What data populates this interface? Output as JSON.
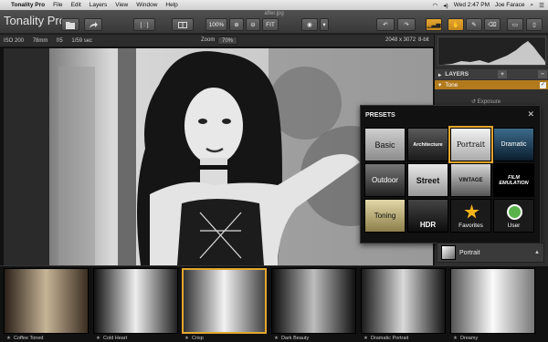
{
  "menubar": {
    "app_name": "Tonality Pro",
    "menus": [
      "File",
      "Edit",
      "Layers",
      "View",
      "Window",
      "Help"
    ],
    "clock": "Wed 2:47 PM",
    "user": "Joe Farace"
  },
  "toolbar": {
    "logo": "Tonality Pro",
    "doc_title": "after.jpg",
    "zoom_percent": "100%",
    "fit_label": "FIT"
  },
  "infobar": {
    "iso": "ISO 200",
    "focal": "78mm",
    "aperture": "f/5",
    "shutter": "1/59 sec",
    "zoom_label": "Zoom",
    "zoom_value": "70%",
    "dimensions": "2048 x 3072",
    "bit_depth": "8-bit"
  },
  "panel": {
    "layers_label": "LAYERS",
    "tone_label": "Tone",
    "exposure_label": "Exposure"
  },
  "presets": {
    "title": "PRESETS",
    "tiles": [
      {
        "label": "Basic",
        "icon": ""
      },
      {
        "label": "Architecture",
        "icon": ""
      },
      {
        "label": "Portrait",
        "icon": ""
      },
      {
        "label": "Dramatic",
        "icon": ""
      },
      {
        "label": "Outdoor",
        "icon": ""
      },
      {
        "label": "Street",
        "icon": ""
      },
      {
        "label": "VINTAGE",
        "icon": ""
      },
      {
        "label": "FILM EMULATION",
        "icon": ""
      },
      {
        "label": "Toning",
        "icon": ""
      },
      {
        "label": "HDR",
        "icon": ""
      },
      {
        "label": "Favorites",
        "icon": "star-icon"
      },
      {
        "label": "User",
        "icon": "user-icon"
      }
    ],
    "selected_index": 2,
    "category": "Portrait"
  },
  "filmstrip": [
    {
      "label": "Coffee Toned"
    },
    {
      "label": "Cold Heart"
    },
    {
      "label": "Crisp"
    },
    {
      "label": "Dark Beauty"
    },
    {
      "label": "Dramatic Portrait"
    },
    {
      "label": "Dreamy"
    }
  ],
  "colors": {
    "accent": "#e3a62f",
    "panel": "#2f2f2f"
  }
}
